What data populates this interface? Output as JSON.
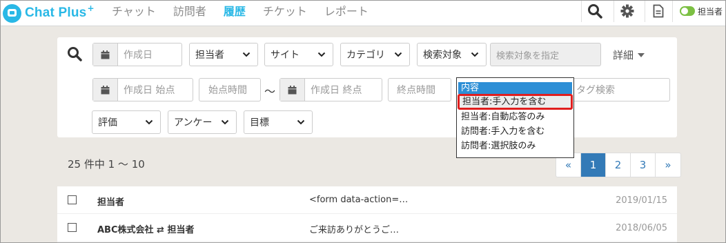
{
  "app": {
    "logo_text": "Chat Plus",
    "logo_plus": "+"
  },
  "nav": [
    "チャット",
    "訪問者",
    "履歴",
    "チケット",
    "レポート"
  ],
  "header": {
    "toggle_label": "担当者"
  },
  "filters": {
    "created_date_placeholder": "作成日",
    "assignee_label": "担当者",
    "site_label": "サイト",
    "category_label": "カテゴリ",
    "search_target_label": "検索対象",
    "search_target_input_placeholder": "検索対象を指定",
    "detail_label": "詳細",
    "start_date_placeholder": "作成日 始点",
    "start_time_placeholder": "始点時間",
    "tilde": "〜",
    "end_date_placeholder": "作成日 終点",
    "end_time_placeholder": "終点時間",
    "tag_search_placeholder": "タグ検索",
    "rating_label": "評価",
    "survey_label": "アンケー",
    "goal_label": "目標"
  },
  "search_target_dropdown": {
    "header": "内容",
    "options": [
      "担当者:手入力を含む",
      "担当者:自動応答のみ",
      "訪問者:手入力を含む",
      "訪問者:選択肢のみ"
    ],
    "highlighted_index": 0
  },
  "results": {
    "count_text": "25 件中 1 〜 10",
    "pagination": [
      "«",
      "1",
      "2",
      "3",
      "»"
    ],
    "current_page": "1",
    "rows": [
      {
        "who": "担当者",
        "message": "<form data-action=…",
        "date": "2019/01/15"
      },
      {
        "who": "ABC株式会社 ⇄ 担当者",
        "message": "ご来訪ありがとうご…",
        "date": "2018/06/05"
      }
    ]
  },
  "colors": {
    "brand": "#29b8e6",
    "accent_blue": "#337ab7",
    "toggle_on": "#7cc043",
    "highlight_red": "#e01e1e",
    "dropdown_header": "#2d8fd6"
  }
}
